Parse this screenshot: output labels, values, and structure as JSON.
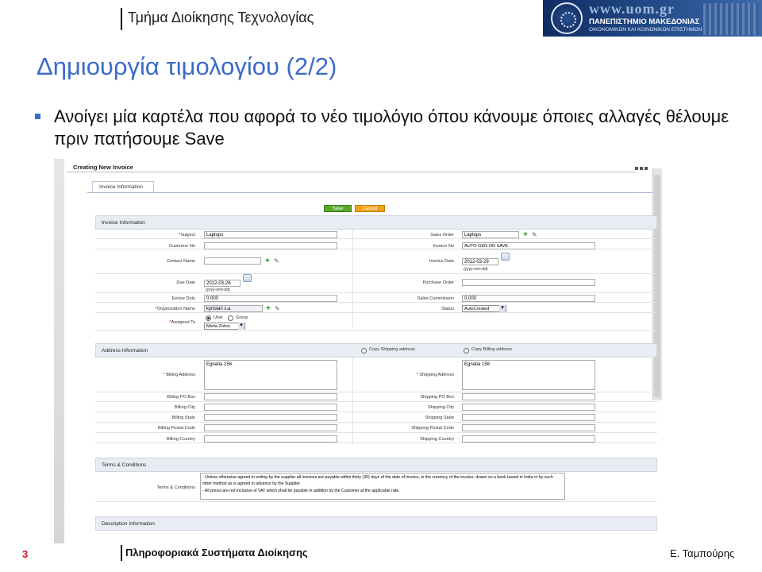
{
  "header": {
    "department": "Τμήμα Διοίκησης Τεχνολογίας",
    "logo_url_text": "www.uom.gr",
    "logo_name": "ΠΑΝΕΠΙΣΤΗΜΙΟ ΜΑΚΕΔΟΝΙΑΣ",
    "logo_subtitle": "ΟΙΚΟΝΟΜΙΚΩΝ ΚΑΙ ΚΟΙΝΩΝΙΚΩΝ ΕΠΙΣΤΗΜΩΝ"
  },
  "slide": {
    "title": "Δημιουργία τιμολογίου (2/2)",
    "bullet": "Ανοίγει μία καρτέλα που αφορά το νέο τιμολόγιο όπου κάνουμε όποιες αλλαγές θέλουμε πριν πατήσουμε Save"
  },
  "screenshot": {
    "window_title": "Creating New Invoice",
    "tab": "Invoice Information",
    "buttons": {
      "save": "Save",
      "cancel": "Cancel"
    },
    "invoice_section": "Invoice Information",
    "fields": {
      "subject_label": "Subject",
      "subject_value": "Laptops",
      "sales_order_label": "Sales Order",
      "sales_order_value": "Laptops",
      "customer_no_label": "Customer No",
      "customer_no_value": "",
      "invoice_no_label": "Invoice No",
      "invoice_no_value": "AUTO GEN ON SAVE",
      "contact_name_label": "Contact Name",
      "contact_name_value": "",
      "invoice_date_label": "Invoice Date",
      "invoice_date_value": "2012-03-29",
      "date_format_hint": "(yyyy-mm-dd)",
      "due_date_label": "Due Date",
      "due_date_value": "2012-03-26",
      "purchase_order_label": "Purchase Order",
      "purchase_order_value": "",
      "excise_duty_label": "Excise Duty",
      "excise_duty_value": "0.000",
      "sales_commission_label": "Sales Commission",
      "sales_commission_value": "0.000",
      "organization_label": "Organization Name",
      "organization_value": "kyriolari s.a",
      "status_label": "Status",
      "status_value": "AutoCreated",
      "assigned_label": "Assigned To",
      "assigned_user": "User",
      "assigned_group": "Group",
      "assigned_value": "Maria Zotou"
    },
    "address_section": "Address Information",
    "copy_shipping": "Copy Shipping address",
    "copy_billing": "Copy Billing address",
    "address": {
      "billing_address_label": "Billing Address",
      "billing_address_value": "Egnatia 156",
      "shipping_address_label": "Shipping Address",
      "shipping_address_value": "Egnatia 156",
      "billing_po_label": "Billing PO Box",
      "shipping_po_label": "Shipping PO Box",
      "billing_city_label": "Billing City",
      "shipping_city_label": "Shipping City",
      "billing_state_label": "Billing State",
      "shipping_state_label": "Shipping State",
      "billing_postal_label": "Billing Postal Code",
      "shipping_postal_label": "Shipping Postal Code",
      "billing_country_label": "Billing Country",
      "shipping_country_label": "Shipping Country"
    },
    "terms_section": "Terms & Conditions",
    "terms_label": "Terms & Conditions",
    "terms_line1": "- Unless otherwise agreed in writing by the supplier all invoices are payable within thirty (30) days of the date of invoice, in the currency of the invoice, drawn on a bank based in India or by such other method as is agreed in advance by the Supplier.",
    "terms_line2": "- All prices are not inclusive of VAT which shall be payable in addition by the Customer at the applicable rate.",
    "description_section": "Description Information"
  },
  "footer": {
    "page_number": "3",
    "course": "Πληροφοριακά Συστήματα Διοίκησης",
    "author": "Ε. Ταμπούρης"
  },
  "colors": {
    "title_blue": "#3b6bc9",
    "save_green": "#5aa82a",
    "cancel_orange": "#f2a219",
    "page_number_red": "#d0101e"
  }
}
